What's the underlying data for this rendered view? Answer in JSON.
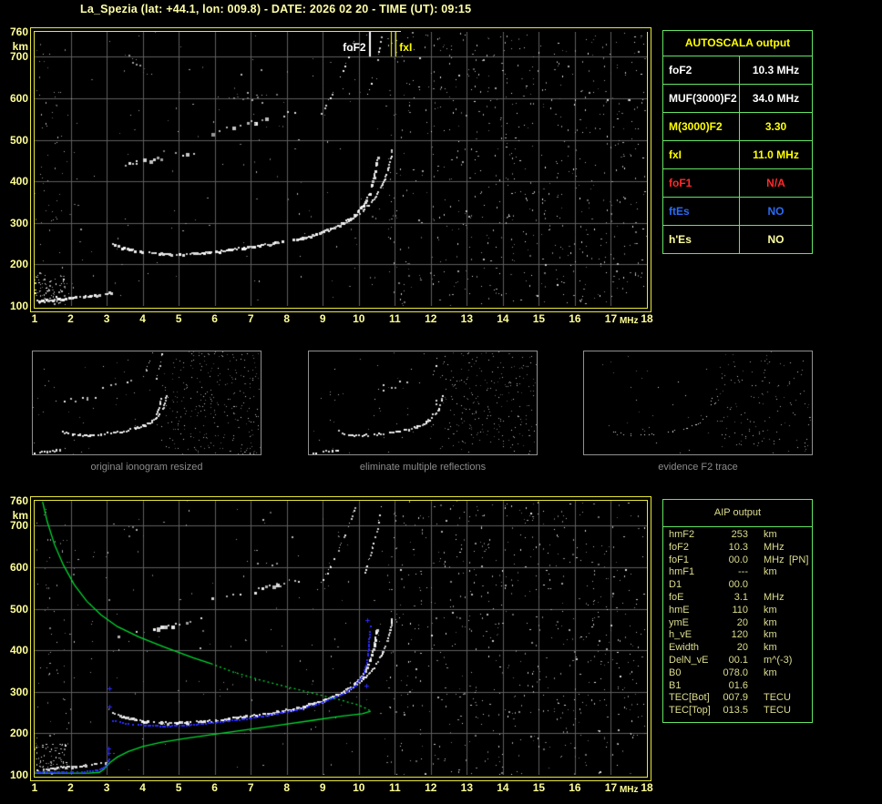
{
  "title": "La_Spezia (lat: +44.1, lon: 009.8) - DATE: 2026 02 20 - TIME (UT): 09:15",
  "colors": {
    "background": "#000000",
    "title_text": "#ffffa6",
    "axis_text": "#ffff96",
    "plot_border": "#e8e83a",
    "grid": "#5e5e5e",
    "table_border": "#63e463",
    "caption_text": "#8c8c8c",
    "profile_green": "#00d930",
    "restored_trace_blue": "#2b2bff",
    "row_palette": {
      "white": "#ffffff",
      "yellow": "#ffff00",
      "red": "#ff2a2a",
      "blue": "#2b6bf2",
      "pale_yellow": "#ffffa0"
    }
  },
  "autoscala_table": {
    "header": "AUTOSCALA output",
    "rows": [
      {
        "label": "foF2",
        "value": "10.3 MHz",
        "color": "white"
      },
      {
        "label": "MUF(3000)F2",
        "value": "34.0 MHz",
        "color": "white"
      },
      {
        "label": "M(3000)F2",
        "value": "3.30",
        "color": "yellow"
      },
      {
        "label": "fxI",
        "value": "11.0 MHz",
        "color": "yellow"
      },
      {
        "label": "foF1",
        "value": "N/A",
        "color": "red"
      },
      {
        "label": "ftEs",
        "value": "NO",
        "color": "blue"
      },
      {
        "label": "h'Es",
        "value": "NO",
        "color": "pale_yellow"
      }
    ]
  },
  "thumbnails": [
    {
      "caption": "original ionogram resized"
    },
    {
      "caption": "eliminate multiple reflections"
    },
    {
      "caption": "evidence F2 trace"
    }
  ],
  "aip_table": {
    "header": "AIP output",
    "rows": [
      {
        "name": "hmF2",
        "value": "253",
        "unit": "km",
        "note": ""
      },
      {
        "name": "foF2",
        "value": "10.3",
        "unit": "MHz",
        "note": ""
      },
      {
        "name": "foF1",
        "value": "00.0",
        "unit": "MHz",
        "note": "[PN]"
      },
      {
        "name": "hmF1",
        "value": "---",
        "unit": "km",
        "note": ""
      },
      {
        "name": "D1",
        "value": "00.0",
        "unit": "",
        "note": ""
      },
      {
        "name": "foE",
        "value": "3.1",
        "unit": "MHz",
        "note": ""
      },
      {
        "name": "hmE",
        "value": "110",
        "unit": "km",
        "note": ""
      },
      {
        "name": "ymE",
        "value": "20",
        "unit": "km",
        "note": ""
      },
      {
        "name": "h_vE",
        "value": "120",
        "unit": "km",
        "note": ""
      },
      {
        "name": "Ewidth",
        "value": "20",
        "unit": "km",
        "note": ""
      },
      {
        "name": "DelN_vE",
        "value": "00.1",
        "unit": "m^(-3)",
        "note": ""
      },
      {
        "name": "B0",
        "value": "078.0",
        "unit": "km",
        "note": ""
      },
      {
        "name": "B1",
        "value": "01.6",
        "unit": "",
        "note": ""
      },
      {
        "name": "TEC[Bot]",
        "value": "007.9",
        "unit": "TECU",
        "note": ""
      },
      {
        "name": "TEC[Top]",
        "value": "013.5",
        "unit": "TECU",
        "note": ""
      }
    ]
  },
  "chart_data": [
    {
      "type": "scatter",
      "title": "scaled ionogram with autoscaled characteristics",
      "xlabel": "MHz",
      "ylabel": "km",
      "xlim": [
        1,
        18
      ],
      "ylim": [
        100,
        760
      ],
      "grid": true,
      "x_ticks": [
        1,
        2,
        3,
        4,
        5,
        6,
        7,
        8,
        9,
        10,
        11,
        12,
        13,
        14,
        15,
        16,
        17,
        18
      ],
      "y_ticks": [
        760,
        700,
        600,
        500,
        400,
        300,
        200,
        100
      ],
      "markers": [
        {
          "label": "foF2",
          "freq": 10.3,
          "color": "#ffffff",
          "style": "single"
        },
        {
          "label": "fxI",
          "freq": 11.0,
          "color": "#ffff00",
          "style": "double"
        }
      ],
      "traces": [
        {
          "name": "E-layer trace",
          "style": "blob",
          "points": [
            [
              1.05,
              114
            ],
            [
              1.3,
              116
            ],
            [
              1.6,
              118
            ],
            [
              2.0,
              121
            ],
            [
              2.4,
              124
            ],
            [
              2.7,
              128
            ],
            [
              2.95,
              131
            ],
            [
              3.1,
              134
            ]
          ]
        },
        {
          "name": "F2 ordinary trace",
          "style": "blob",
          "points": [
            [
              3.15,
              252
            ],
            [
              3.45,
              241
            ],
            [
              3.9,
              232
            ],
            [
              4.5,
              227
            ],
            [
              5.2,
              227
            ],
            [
              6.0,
              233
            ],
            [
              6.8,
              242
            ],
            [
              7.6,
              252
            ],
            [
              8.4,
              265
            ],
            [
              9.0,
              281
            ],
            [
              9.5,
              299
            ],
            [
              9.85,
              320
            ],
            [
              10.1,
              344
            ],
            [
              10.28,
              374
            ],
            [
              10.4,
              412
            ],
            [
              10.47,
              448
            ],
            [
              10.5,
              462
            ]
          ]
        },
        {
          "name": "F2 extraordinary trace",
          "style": "blob2",
          "points": [
            [
              8.6,
              268
            ],
            [
              9.2,
              286
            ],
            [
              9.7,
              306
            ],
            [
              10.1,
              331
            ],
            [
              10.4,
              360
            ],
            [
              10.65,
              396
            ],
            [
              10.8,
              432
            ],
            [
              10.88,
              462
            ],
            [
              10.9,
              476
            ]
          ]
        },
        {
          "name": "second hop band low",
          "style": "patch",
          "points": [
            [
              3.3,
              440
            ],
            [
              3.8,
              448
            ],
            [
              4.4,
              457
            ],
            [
              5.0,
              467
            ],
            [
              5.6,
              478
            ]
          ]
        },
        {
          "name": "second hop band high",
          "style": "patch",
          "points": [
            [
              5.9,
              522
            ],
            [
              6.5,
              533
            ],
            [
              7.1,
              544
            ],
            [
              7.7,
              557
            ],
            [
              8.3,
              568
            ]
          ]
        },
        {
          "name": "upper scatter cluster",
          "style": "dots_gray",
          "points": [
            [
              6.4,
              596
            ],
            [
              6.9,
              608
            ],
            [
              7.3,
              600
            ],
            [
              7.7,
              612
            ]
          ]
        },
        {
          "name": "second hop steep 1",
          "style": "streak",
          "points": [
            [
              8.95,
              565
            ],
            [
              9.2,
              602
            ],
            [
              9.45,
              648
            ],
            [
              9.7,
              700
            ],
            [
              9.9,
              752
            ]
          ]
        },
        {
          "name": "second hop steep 2",
          "style": "streak",
          "points": [
            [
              10.15,
              588
            ],
            [
              10.33,
              638
            ],
            [
              10.5,
              695
            ],
            [
              10.62,
              750
            ]
          ]
        },
        {
          "name": "top left scatter",
          "style": "dots_gray",
          "points": [
            [
              3.5,
              712
            ],
            [
              3.8,
              688
            ],
            [
              4.1,
              662
            ],
            [
              4.4,
              642
            ]
          ]
        },
        {
          "name": "bottom left diagonal",
          "style": "dots_gray",
          "points": [
            [
              1.05,
              195
            ],
            [
              1.25,
              160
            ],
            [
              1.45,
              128
            ]
          ]
        }
      ]
    },
    {
      "type": "scatter",
      "title": "ionogram with restored trace and electron density profile",
      "xlabel": "MHz",
      "ylabel": "km",
      "xlim": [
        1,
        18
      ],
      "ylim": [
        100,
        760
      ],
      "grid": true,
      "x_ticks": [
        1,
        2,
        3,
        4,
        5,
        6,
        7,
        8,
        9,
        10,
        11,
        12,
        13,
        14,
        15,
        16,
        17,
        18
      ],
      "y_ticks": [
        760,
        700,
        600,
        500,
        400,
        300,
        200,
        100
      ],
      "white_traces_same_as": 0,
      "profile": [
        {
          "name": "topside profile solid",
          "style": "green_solid",
          "points": [
            [
              1.22,
              758
            ],
            [
              1.35,
              710
            ],
            [
              1.55,
              655
            ],
            [
              1.8,
              605
            ],
            [
              2.1,
              558
            ],
            [
              2.45,
              518
            ],
            [
              2.85,
              485
            ],
            [
              3.3,
              457
            ],
            [
              3.9,
              432
            ],
            [
              4.6,
              408
            ],
            [
              5.4,
              382
            ],
            [
              5.9,
              368
            ]
          ]
        },
        {
          "name": "topside profile dotted",
          "style": "green_dotted",
          "points": [
            [
              5.9,
              368
            ],
            [
              6.5,
              348
            ],
            [
              7.2,
              330
            ],
            [
              8.0,
              312
            ],
            [
              8.8,
              295
            ],
            [
              9.5,
              280
            ],
            [
              10.0,
              268
            ],
            [
              10.25,
              258
            ],
            [
              10.33,
              253
            ]
          ]
        },
        {
          "name": "bottomside profile",
          "style": "green_solid",
          "points": [
            [
              10.33,
              253
            ],
            [
              10.1,
              247
            ],
            [
              9.5,
              241
            ],
            [
              8.7,
              231
            ],
            [
              7.8,
              220
            ],
            [
              6.9,
              209
            ],
            [
              6.0,
              198
            ],
            [
              5.2,
              188
            ],
            [
              4.5,
              178
            ],
            [
              4.0,
              168
            ],
            [
              3.6,
              156
            ],
            [
              3.3,
              143
            ],
            [
              3.1,
              130
            ],
            [
              3.0,
              121
            ],
            [
              2.92,
              113
            ],
            [
              2.8,
              106
            ],
            [
              2.5,
              104
            ],
            [
              1.0,
              104
            ]
          ]
        }
      ],
      "restored_trace": [
        {
          "name": "restored E trace",
          "style": "blue_dots",
          "points": [
            [
              1.0,
              108
            ],
            [
              1.6,
              108
            ],
            [
              2.3,
              109
            ],
            [
              2.6,
              111
            ],
            [
              2.85,
              117
            ],
            [
              3.0,
              128
            ],
            [
              3.05,
              140
            ]
          ]
        },
        {
          "name": "restored F2 trace",
          "style": "blue_dots",
          "points": [
            [
              3.15,
              232
            ],
            [
              3.5,
              226
            ],
            [
              4.0,
              221
            ],
            [
              4.6,
              219
            ],
            [
              5.2,
              221
            ],
            [
              6.0,
              228
            ],
            [
              6.8,
              236
            ],
            [
              7.6,
              247
            ],
            [
              8.4,
              261
            ],
            [
              9.0,
              277
            ],
            [
              9.5,
              295
            ],
            [
              9.9,
              318
            ],
            [
              10.1,
              342
            ],
            [
              10.2,
              372
            ],
            [
              10.25,
              405
            ],
            [
              10.28,
              440
            ],
            [
              10.3,
              460
            ]
          ]
        },
        {
          "name": "restored trace plus marks",
          "style": "blue_plus",
          "points": [
            [
              3.05,
              152
            ],
            [
              3.06,
              163
            ],
            [
              3.08,
              264
            ],
            [
              3.08,
              308
            ],
            [
              10.2,
              314
            ],
            [
              10.24,
              472
            ]
          ]
        }
      ]
    }
  ]
}
